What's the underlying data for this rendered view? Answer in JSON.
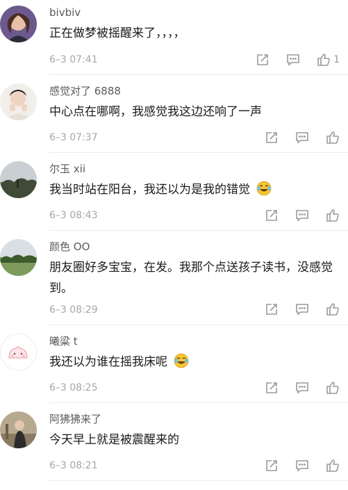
{
  "comments": [
    {
      "user": "bivbiv",
      "text": "正在做梦被摇醒来了，，，，",
      "time": "6–3 07:41",
      "likes": "1",
      "has_emoji": false
    },
    {
      "user": "感觉对了 6888",
      "text": "中心点在哪啊，我感觉我这边还响了一声",
      "time": "6–3 07:37",
      "likes": "",
      "has_emoji": false
    },
    {
      "user": "尔玉 xii",
      "text": "我当时站在阳台，我还以为是我的错觉",
      "time": "6–3 08:43",
      "likes": "",
      "has_emoji": true
    },
    {
      "user": "颜色 OO",
      "text": "朋友圈好多宝宝，在发。我那个点送孩子读书，没感觉到。",
      "time": "6–3 08:29",
      "likes": "",
      "has_emoji": false
    },
    {
      "user": "曦粱 t",
      "text": "我还以为谁在摇我床呢",
      "time": "6–3 08:25",
      "likes": "",
      "has_emoji": true
    },
    {
      "user": "阿狒狒来了",
      "text": "今天早上就是被震醒来的",
      "time": "6–3 08:21",
      "likes": "",
      "has_emoji": false
    }
  ],
  "icons": {
    "share": "share-icon",
    "reply": "comment-icon",
    "like": "thumbs-up-icon",
    "emoji": "laughing-crying-emoji-icon"
  }
}
